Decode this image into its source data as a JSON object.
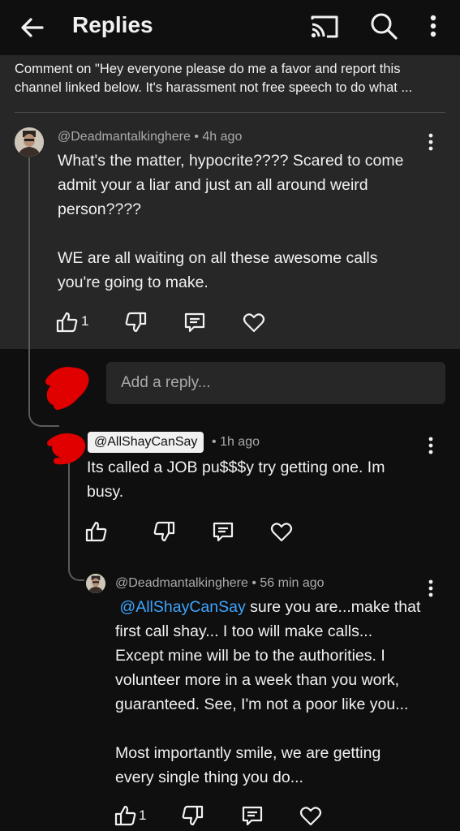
{
  "header": {
    "title": "Replies",
    "back_icon": "arrow-left-icon",
    "cast_icon": "cast-icon",
    "search_icon": "search-icon",
    "more_icon": "more-vertical-icon"
  },
  "original_comment": {
    "line1": "Comment on \"Hey everyone please do me a favor and report this",
    "line2": "channel linked below. It's harassment not free speech to do what ..."
  },
  "parent_comment": {
    "author": "@Deadmantalkinghere",
    "time": "4h ago",
    "paragraph1_line1": "What's the matter, hypocrite???? Scared to come",
    "paragraph1_line2": "admit your a liar and just an all around weird",
    "paragraph1_line3": "person????",
    "paragraph2_line1": "WE are all waiting on all these awesome calls",
    "paragraph2_line2": "you're going to make.",
    "likes": "1"
  },
  "reply_input": {
    "placeholder": "Add a reply..."
  },
  "replies": [
    {
      "author": "@AllShayCanSay",
      "time": "1h ago",
      "line1": "Its called a JOB pu$$$y try getting one. Im",
      "line2": "busy."
    },
    {
      "author": "@Deadmantalkinghere",
      "time": "56 min ago",
      "mention": "@AllShayCanSay",
      "line1_rest": " sure you are...make that",
      "line2": "first call shay... I too will make calls...",
      "line3": "Except mine will be to the authorities. I",
      "line4": "volunteer more in a week than you work,",
      "line5": "guaranteed. See, I'm not a poor like you...",
      "line6": "Most importantly smile, we are getting",
      "line7": "every single thing you do...",
      "likes": "1"
    }
  ],
  "separator": "•",
  "colors": {
    "background": "#0f0f0f",
    "highlight_panel": "#272727",
    "mention": "#3ea6ff",
    "redaction": "#e00000"
  }
}
